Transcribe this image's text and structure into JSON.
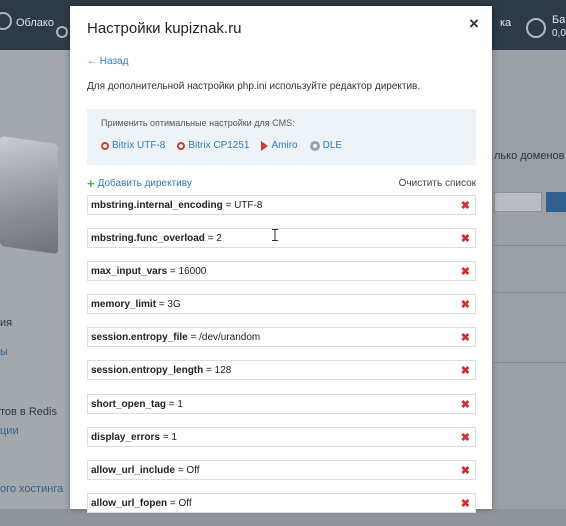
{
  "background": {
    "topbar": {
      "left_item": "Облако",
      "right_item_a": "ка",
      "right_item_b": "Ба",
      "right_item_b_sub": "0,0"
    },
    "sidebar": {
      "heading": "ия",
      "link_a": "ы",
      "redis_text": "тов в Redis",
      "link_b": "ции",
      "hosting_link": "ого хостинга"
    },
    "right_panel": {
      "text": "лько доменов л"
    }
  },
  "modal": {
    "title": "Настройки kupiznak.ru",
    "close_label": "×",
    "back_label": "← Назад",
    "intro": "Для дополнительной настройки php.ini используйте редактор директив.",
    "cms": {
      "caption": "Применить оптимальные настройки для CMS:",
      "options": [
        {
          "label": "Bitrix UTF-8",
          "icon": "bitrix-icon"
        },
        {
          "label": "Bitrix CP1251",
          "icon": "bitrix-icon"
        },
        {
          "label": "Amiro",
          "icon": "amiro-icon"
        },
        {
          "label": "DLE",
          "icon": "dle-icon"
        }
      ]
    },
    "add_label": "Добавить директиву",
    "clear_label": "Очистить список",
    "delete_label": "✖",
    "directives": [
      {
        "key": "mbstring.internal_encoding",
        "value": " = UTF-8"
      },
      {
        "key": "mbstring.func_overload",
        "value": " = 2"
      },
      {
        "key": "max_input_vars",
        "value": " = 16000"
      },
      {
        "key": "memory_limit",
        "value": " = 3G"
      },
      {
        "key": "session.entropy_file",
        "value": " = /dev/urandom"
      },
      {
        "key": "session.entropy_length",
        "value": " = 128"
      },
      {
        "key": "short_open_tag",
        "value": " = 1"
      },
      {
        "key": "display_errors",
        "value": " = 1"
      },
      {
        "key": "allow_url_include",
        "value": " = Off"
      },
      {
        "key": "allow_url_fopen",
        "value": " = Off"
      }
    ]
  }
}
